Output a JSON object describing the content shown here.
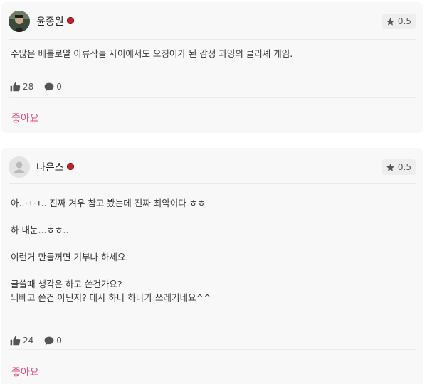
{
  "reviews": [
    {
      "username": "윤종원",
      "rating": "0.5",
      "lines": [
        "수많은 배틀로얄 아류작들 사이에서도 오징어가 된 감정 과잉의 클리셰 게임."
      ],
      "likes": "28",
      "comments": "0",
      "like_button": "좋아요"
    },
    {
      "username": "나은스",
      "rating": "0.5",
      "lines": [
        "아..ㅋㅋ.. 진짜 겨우 참고 봤는데 진짜 최악이다 ㅎㅎ",
        "",
        "하 내눈...ㅎㅎ..",
        "",
        "이런거 만들꺼면 기부나 하세요.",
        "",
        "글쓸때 생각은 하고 쓴건가요?",
        "뇌빼고 쓴건 아닌지? 대사 하나 하나가 쓰레기네요^^"
      ],
      "likes": "24",
      "comments": "0",
      "like_button": "좋아요"
    }
  ],
  "icons": {
    "rating": "star-icon",
    "likes": "thumbs-up-icon",
    "comments": "speech-bubble-icon",
    "badge": "red-dot-badge",
    "default_avatar": "person-icon"
  },
  "colors": {
    "like_button": "#e0457f",
    "badge": "#c0212b",
    "card_bg": "#f8f8f8"
  }
}
